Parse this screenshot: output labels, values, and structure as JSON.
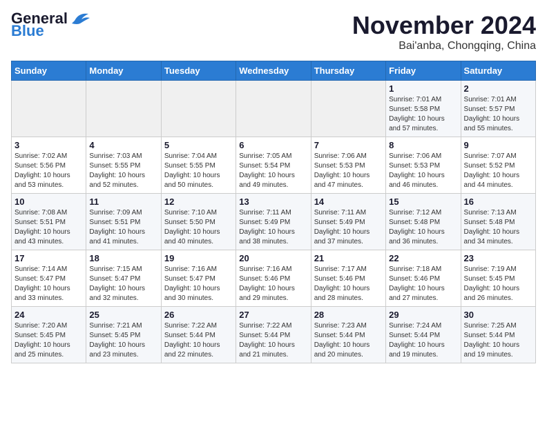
{
  "header": {
    "logo_general": "General",
    "logo_blue": "Blue",
    "month_title": "November 2024",
    "location": "Bai'anba, Chongqing, China"
  },
  "days_of_week": [
    "Sunday",
    "Monday",
    "Tuesday",
    "Wednesday",
    "Thursday",
    "Friday",
    "Saturday"
  ],
  "weeks": [
    [
      {
        "day": "",
        "info": ""
      },
      {
        "day": "",
        "info": ""
      },
      {
        "day": "",
        "info": ""
      },
      {
        "day": "",
        "info": ""
      },
      {
        "day": "",
        "info": ""
      },
      {
        "day": "1",
        "info": "Sunrise: 7:01 AM\nSunset: 5:58 PM\nDaylight: 10 hours and 57 minutes."
      },
      {
        "day": "2",
        "info": "Sunrise: 7:01 AM\nSunset: 5:57 PM\nDaylight: 10 hours and 55 minutes."
      }
    ],
    [
      {
        "day": "3",
        "info": "Sunrise: 7:02 AM\nSunset: 5:56 PM\nDaylight: 10 hours and 53 minutes."
      },
      {
        "day": "4",
        "info": "Sunrise: 7:03 AM\nSunset: 5:55 PM\nDaylight: 10 hours and 52 minutes."
      },
      {
        "day": "5",
        "info": "Sunrise: 7:04 AM\nSunset: 5:55 PM\nDaylight: 10 hours and 50 minutes."
      },
      {
        "day": "6",
        "info": "Sunrise: 7:05 AM\nSunset: 5:54 PM\nDaylight: 10 hours and 49 minutes."
      },
      {
        "day": "7",
        "info": "Sunrise: 7:06 AM\nSunset: 5:53 PM\nDaylight: 10 hours and 47 minutes."
      },
      {
        "day": "8",
        "info": "Sunrise: 7:06 AM\nSunset: 5:53 PM\nDaylight: 10 hours and 46 minutes."
      },
      {
        "day": "9",
        "info": "Sunrise: 7:07 AM\nSunset: 5:52 PM\nDaylight: 10 hours and 44 minutes."
      }
    ],
    [
      {
        "day": "10",
        "info": "Sunrise: 7:08 AM\nSunset: 5:51 PM\nDaylight: 10 hours and 43 minutes."
      },
      {
        "day": "11",
        "info": "Sunrise: 7:09 AM\nSunset: 5:51 PM\nDaylight: 10 hours and 41 minutes."
      },
      {
        "day": "12",
        "info": "Sunrise: 7:10 AM\nSunset: 5:50 PM\nDaylight: 10 hours and 40 minutes."
      },
      {
        "day": "13",
        "info": "Sunrise: 7:11 AM\nSunset: 5:49 PM\nDaylight: 10 hours and 38 minutes."
      },
      {
        "day": "14",
        "info": "Sunrise: 7:11 AM\nSunset: 5:49 PM\nDaylight: 10 hours and 37 minutes."
      },
      {
        "day": "15",
        "info": "Sunrise: 7:12 AM\nSunset: 5:48 PM\nDaylight: 10 hours and 36 minutes."
      },
      {
        "day": "16",
        "info": "Sunrise: 7:13 AM\nSunset: 5:48 PM\nDaylight: 10 hours and 34 minutes."
      }
    ],
    [
      {
        "day": "17",
        "info": "Sunrise: 7:14 AM\nSunset: 5:47 PM\nDaylight: 10 hours and 33 minutes."
      },
      {
        "day": "18",
        "info": "Sunrise: 7:15 AM\nSunset: 5:47 PM\nDaylight: 10 hours and 32 minutes."
      },
      {
        "day": "19",
        "info": "Sunrise: 7:16 AM\nSunset: 5:47 PM\nDaylight: 10 hours and 30 minutes."
      },
      {
        "day": "20",
        "info": "Sunrise: 7:16 AM\nSunset: 5:46 PM\nDaylight: 10 hours and 29 minutes."
      },
      {
        "day": "21",
        "info": "Sunrise: 7:17 AM\nSunset: 5:46 PM\nDaylight: 10 hours and 28 minutes."
      },
      {
        "day": "22",
        "info": "Sunrise: 7:18 AM\nSunset: 5:46 PM\nDaylight: 10 hours and 27 minutes."
      },
      {
        "day": "23",
        "info": "Sunrise: 7:19 AM\nSunset: 5:45 PM\nDaylight: 10 hours and 26 minutes."
      }
    ],
    [
      {
        "day": "24",
        "info": "Sunrise: 7:20 AM\nSunset: 5:45 PM\nDaylight: 10 hours and 25 minutes."
      },
      {
        "day": "25",
        "info": "Sunrise: 7:21 AM\nSunset: 5:45 PM\nDaylight: 10 hours and 23 minutes."
      },
      {
        "day": "26",
        "info": "Sunrise: 7:22 AM\nSunset: 5:44 PM\nDaylight: 10 hours and 22 minutes."
      },
      {
        "day": "27",
        "info": "Sunrise: 7:22 AM\nSunset: 5:44 PM\nDaylight: 10 hours and 21 minutes."
      },
      {
        "day": "28",
        "info": "Sunrise: 7:23 AM\nSunset: 5:44 PM\nDaylight: 10 hours and 20 minutes."
      },
      {
        "day": "29",
        "info": "Sunrise: 7:24 AM\nSunset: 5:44 PM\nDaylight: 10 hours and 19 minutes."
      },
      {
        "day": "30",
        "info": "Sunrise: 7:25 AM\nSunset: 5:44 PM\nDaylight: 10 hours and 19 minutes."
      }
    ]
  ]
}
